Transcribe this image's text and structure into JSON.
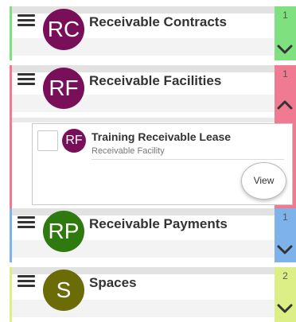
{
  "colors": {
    "contracts_accent": "#7fe07f",
    "facilities_accent": "#f07a92",
    "payments_accent": "#7db3ea",
    "spaces_accent": "#dcef86",
    "contracts_avatar": "#7a0f59",
    "facilities_avatar": "#7a0f59",
    "payments_avatar": "#2f7a0f",
    "spaces_avatar": "#6b6b07"
  },
  "sections": [
    {
      "avatar": "RC",
      "title": "Receivable Contracts",
      "count": "1",
      "chevron": "down"
    },
    {
      "avatar": "RF",
      "title": "Receivable Facilities",
      "count": "1",
      "chevron": "up"
    },
    {
      "avatar": "RP",
      "title": "Receivable Payments",
      "count": "1",
      "chevron": "down"
    },
    {
      "avatar": "S",
      "title": "Spaces",
      "count": "2",
      "chevron": "down"
    }
  ],
  "facility_item": {
    "avatar": "RF",
    "title": "Training Receivable Lease",
    "subtitle": "Receivable Facility",
    "view_label": "View"
  }
}
